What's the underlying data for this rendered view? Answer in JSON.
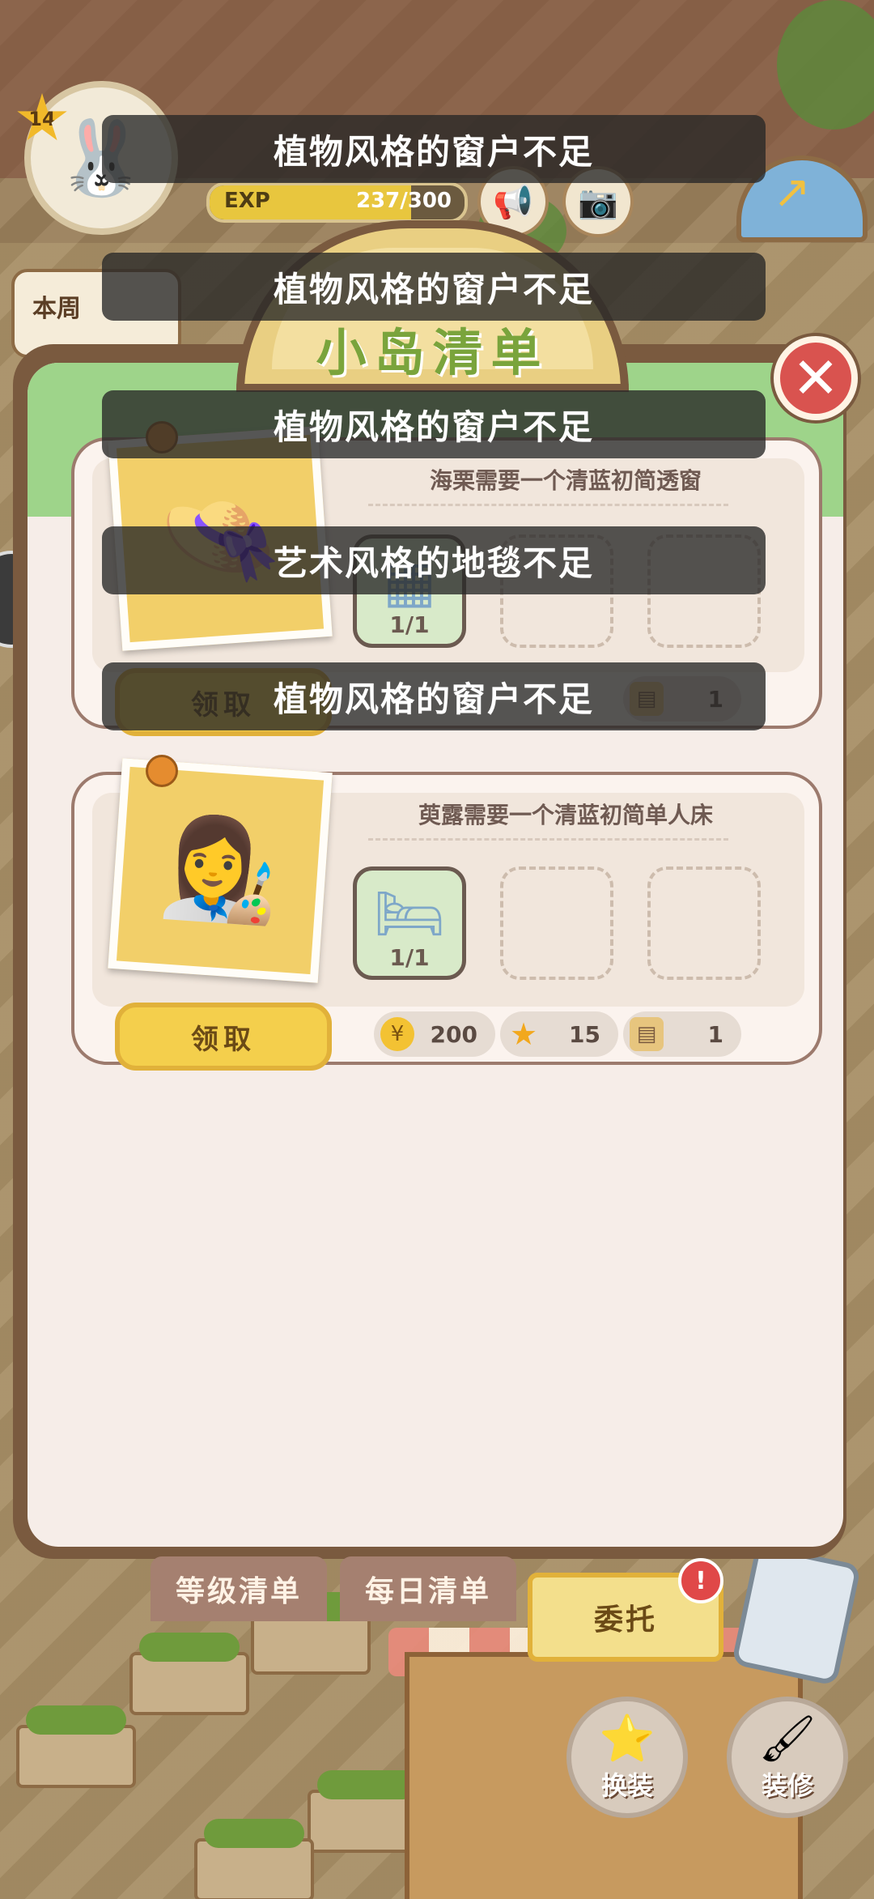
{
  "hud": {
    "level": "14",
    "exp_label": "EXP",
    "exp_value": "237/300",
    "exp_fraction": 0.79,
    "weekly_label": "本周"
  },
  "panel": {
    "title": "小岛清单",
    "close_icon": "close-icon"
  },
  "requests": [
    {
      "text": "海栗需要一个清蓝初简透窗",
      "item_icon": "window-icon",
      "progress": "1/1",
      "claim_label": "领取",
      "rewards": [
        {
          "icon": "box-icon",
          "value": "1"
        }
      ]
    },
    {
      "text": "萸露需要一个清蓝初简单人床",
      "item_icon": "bed-icon",
      "progress": "1/1",
      "claim_label": "领取",
      "rewards": [
        {
          "icon": "coin-icon",
          "value": "200"
        },
        {
          "icon": "star-icon",
          "value": "15"
        },
        {
          "icon": "box-icon",
          "value": "1"
        }
      ]
    }
  ],
  "toasts": [
    "植物风格的窗户不足",
    "植物风格的窗户不足",
    "植物风格的窗户不足",
    "艺术风格的地毯不足",
    "植物风格的窗户不足"
  ],
  "bottom_tabs": {
    "level_list": "等级清单",
    "daily_list": "每日清单",
    "commission": "委托",
    "alert": "!"
  },
  "actions": {
    "dress_up": "换装",
    "decorate": "装修"
  }
}
